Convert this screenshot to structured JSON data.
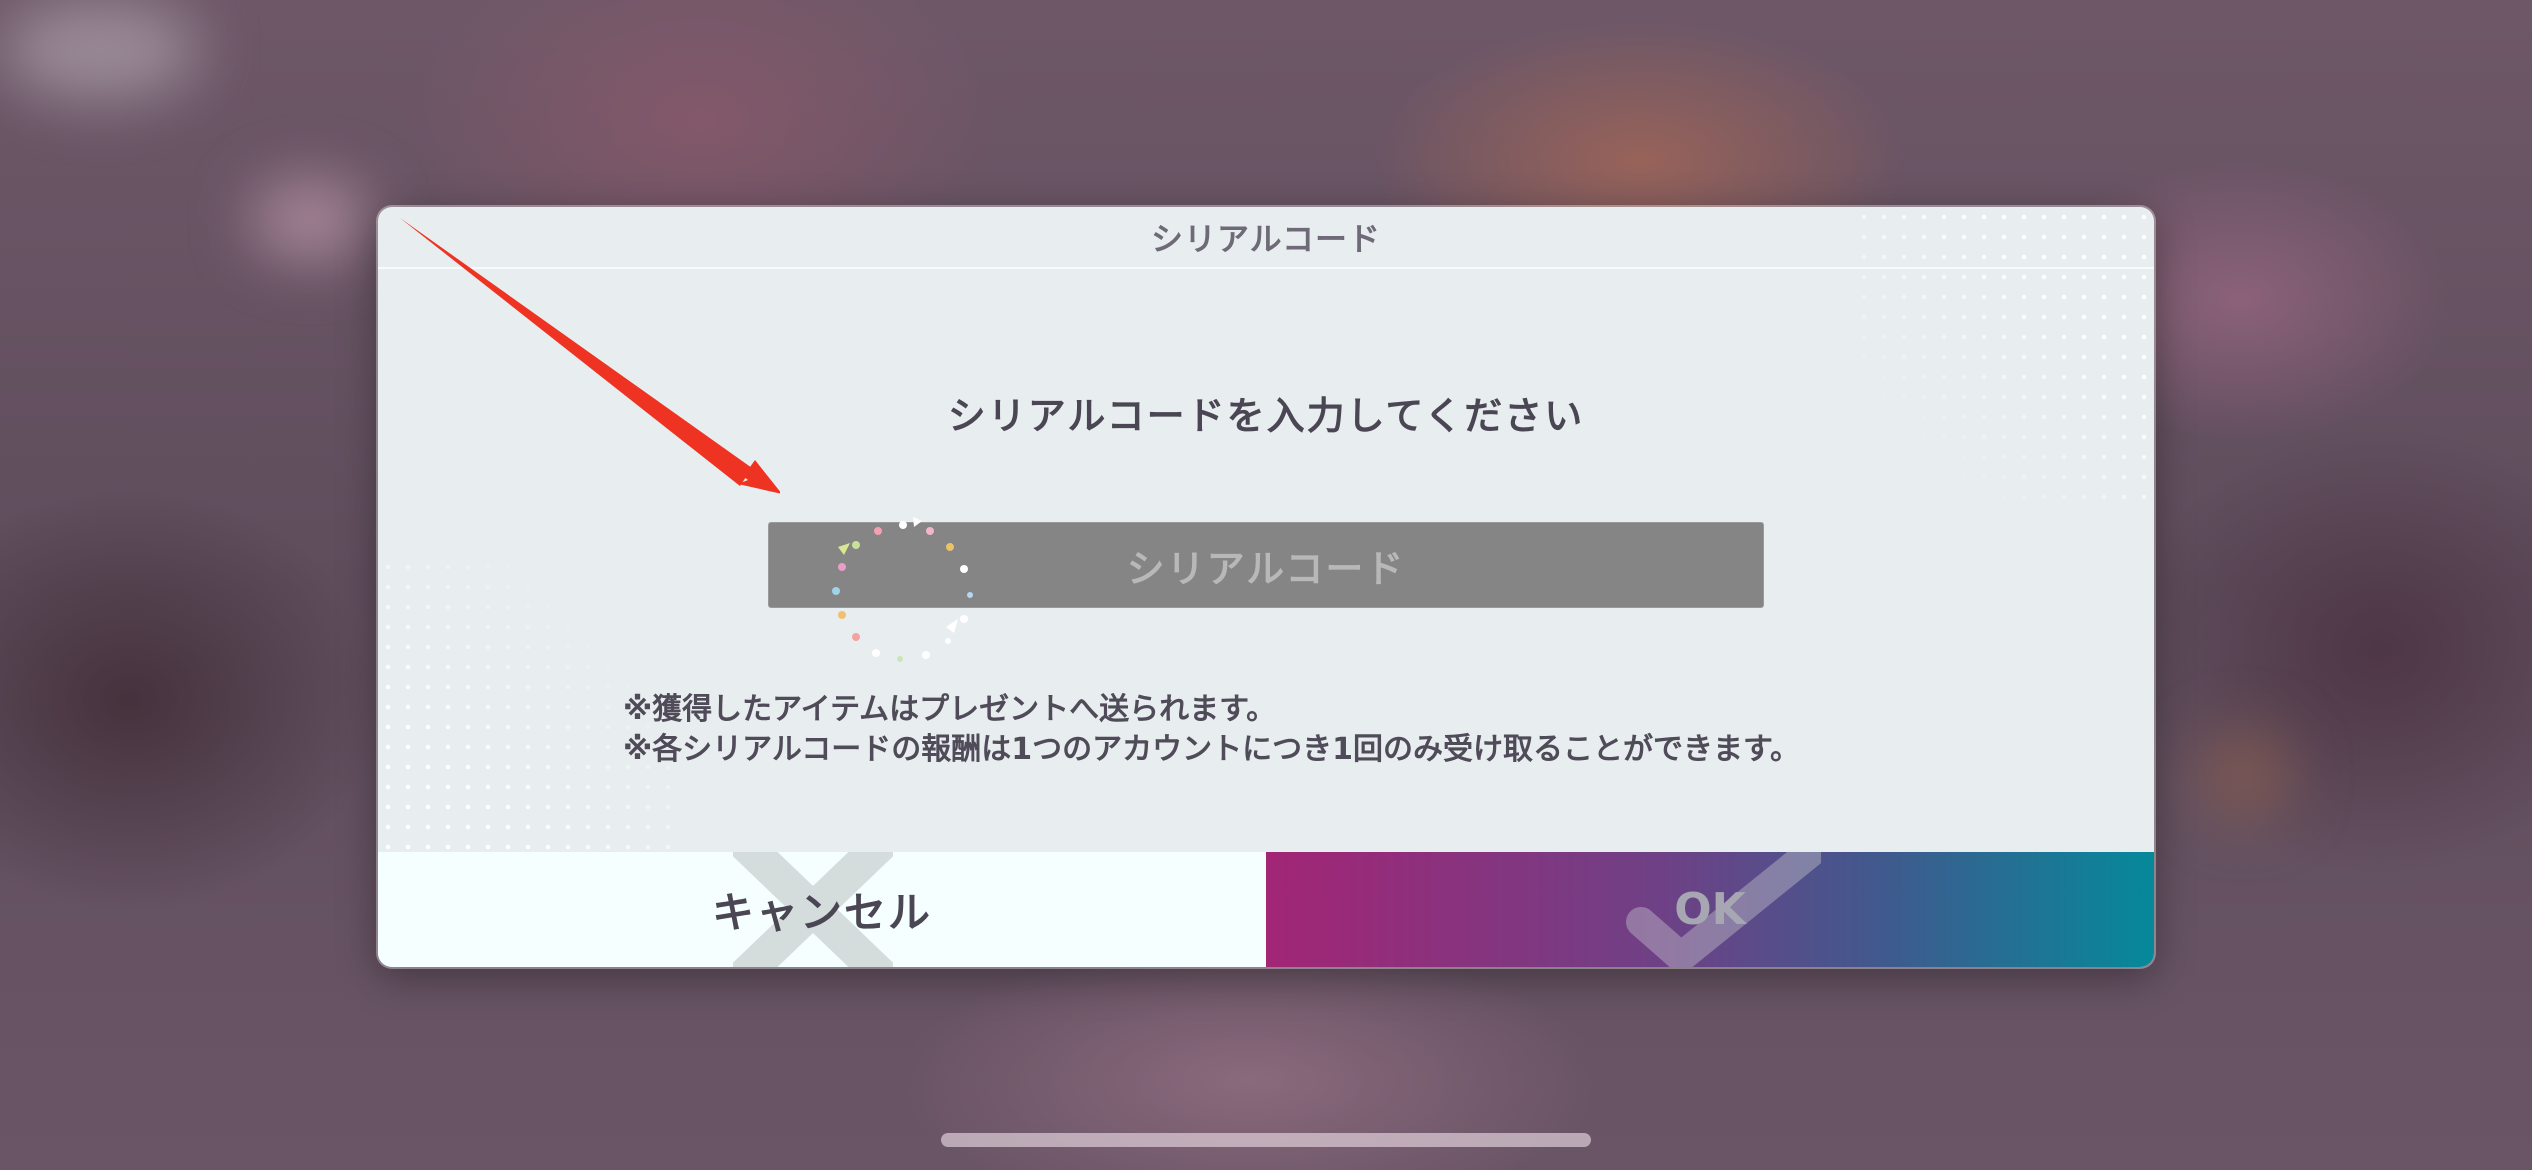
{
  "dialog": {
    "title": "シリアルコード",
    "prompt": "シリアルコードを入力してください",
    "input": {
      "placeholder": "シリアルコード",
      "value": ""
    },
    "notes": [
      "※獲得したアイテムはプレゼントへ送られます。",
      "※各シリアルコードの報酬は1つのアカウントにつき1回のみ受け取ることができます。"
    ],
    "buttons": {
      "cancel_label": "キャンセル",
      "ok_label": "OK"
    }
  },
  "colors": {
    "dialog_bg": "#e8eeef",
    "cancel_bg": "#f6ffff",
    "ok_gradient_start": "#a22576",
    "ok_gradient_end": "#05899a",
    "annotation_arrow": "#ee3322"
  },
  "icons": {
    "cancel_decoration": "x-mark-icon",
    "ok_decoration": "check-mark-icon",
    "loading": "loading-spinner-icon",
    "annotation": "red-arrow-icon"
  }
}
